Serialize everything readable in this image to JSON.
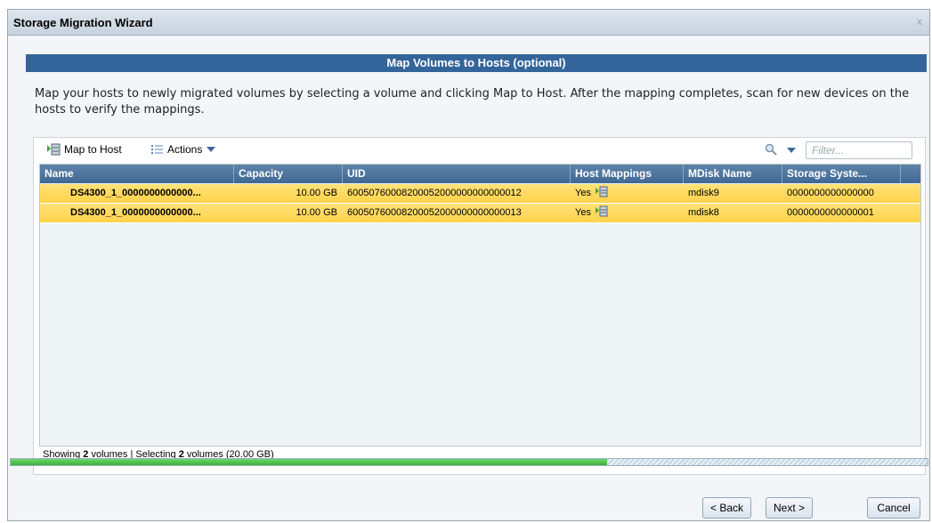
{
  "window": {
    "title": "Storage Migration Wizard",
    "close_glyph": "x"
  },
  "banner": "Map Volumes to Hosts (optional)",
  "description": "Map your hosts to newly migrated volumes by selecting a volume and clicking Map to Host. After the mapping completes, scan for new devices on the hosts to verify the mappings.",
  "toolbar": {
    "map_to_host": "Map to Host",
    "actions": "Actions",
    "filter_placeholder": "Filter..."
  },
  "table": {
    "columns": [
      "Name",
      "Capacity",
      "UID",
      "Host Mappings",
      "MDisk Name",
      "Storage Syste..."
    ],
    "rows": [
      {
        "name": "DS4300_1_0000000000000...",
        "capacity": "10.00 GB",
        "uid": "60050760008200052000000000000012",
        "host_mappings": "Yes",
        "mdisk": "mdisk9",
        "storage": "0000000000000000"
      },
      {
        "name": "DS4300_1_0000000000000...",
        "capacity": "10.00 GB",
        "uid": "60050760008200052000000000000013",
        "host_mappings": "Yes",
        "mdisk": "mdisk8",
        "storage": "0000000000000001"
      }
    ]
  },
  "status": {
    "showing_pre": "Showing ",
    "showing_count": "2",
    "showing_mid": " volumes | Selecting ",
    "selecting_count": "2",
    "selecting_post": " volumes (20.00 GB)"
  },
  "progress": {
    "fraction": 0.65
  },
  "buttons": {
    "back": "< Back",
    "next": "Next >",
    "cancel": "Cancel"
  },
  "colors": {
    "banner": "#34659a",
    "header": "#3f6893",
    "selected_row": "#ffd24a",
    "progress": "#38b038"
  }
}
